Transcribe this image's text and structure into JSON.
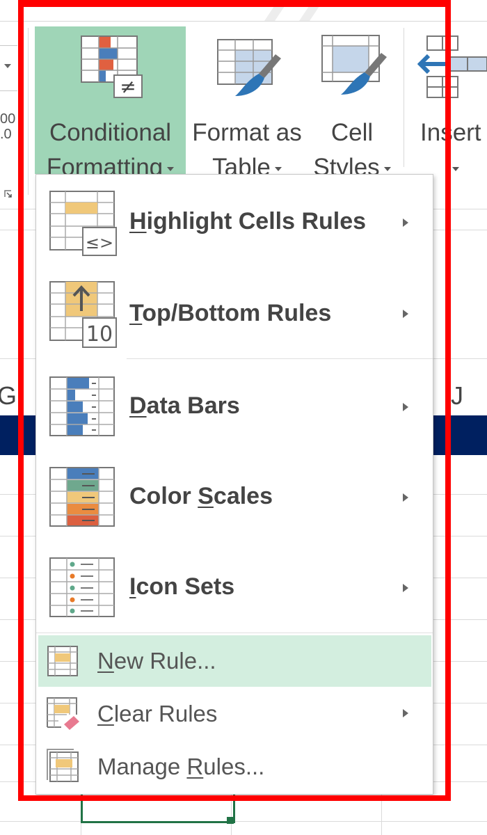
{
  "ribbon": {
    "left_number_format": [
      "00",
      ".0"
    ],
    "buttons": [
      {
        "id": "conditional-formatting",
        "lines": [
          "Conditional",
          "Formatting"
        ],
        "active": true,
        "icon": "conditional-formatting-icon"
      },
      {
        "id": "format-as-table",
        "lines": [
          "Format as",
          "Table"
        ],
        "active": false,
        "icon": "format-as-table-icon"
      },
      {
        "id": "cell-styles",
        "lines": [
          "Cell",
          "Styles"
        ],
        "active": false,
        "icon": "cell-styles-icon"
      },
      {
        "id": "insert",
        "lines": [
          "Insert",
          ""
        ],
        "active": false,
        "icon": "insert-cells-icon"
      }
    ]
  },
  "sheet": {
    "column_letters": [
      "G",
      "J"
    ],
    "header_band_color": "#002060",
    "selection_color": "#217346"
  },
  "menu": {
    "items": [
      {
        "label_pre": "",
        "label_ul": "H",
        "label_post": "ighlight Cells Rules",
        "icon": "highlight-cells-rules-icon",
        "submenu": true,
        "style": "big"
      },
      {
        "label_pre": "",
        "label_ul": "T",
        "label_post": "op/Bottom Rules",
        "icon": "top-bottom-rules-icon",
        "submenu": true,
        "style": "big"
      },
      {
        "label_pre": "",
        "label_ul": "D",
        "label_post": "ata Bars",
        "icon": "data-bars-icon",
        "submenu": true,
        "style": "big"
      },
      {
        "label_pre": "Color ",
        "label_ul": "S",
        "label_post": "cales",
        "icon": "color-scales-icon",
        "submenu": true,
        "style": "big"
      },
      {
        "label_pre": "",
        "label_ul": "I",
        "label_post": "con Sets",
        "icon": "icon-sets-icon",
        "submenu": true,
        "style": "big"
      },
      {
        "label_pre": "",
        "label_ul": "N",
        "label_post": "ew Rule...",
        "icon": "new-rule-icon",
        "submenu": false,
        "style": "small",
        "highlighted": true
      },
      {
        "label_pre": "",
        "label_ul": "C",
        "label_post": "lear Rules",
        "icon": "clear-rules-icon",
        "submenu": true,
        "style": "small"
      },
      {
        "label_pre": "Manage ",
        "label_ul": "R",
        "label_post": "ules...",
        "icon": "manage-rules-icon",
        "submenu": false,
        "style": "small"
      }
    ],
    "badges": {
      "highlight": "≤>",
      "topbottom": "10",
      "cf": "≠"
    }
  },
  "colors": {
    "accent_green": "#9fd5b7",
    "hover_green": "#d3eedf",
    "annotation_red": "#ff0000",
    "bar_blue": "#4a7ebb",
    "bar_orange": "#e06040",
    "cell_yellow": "#f0c87a"
  }
}
